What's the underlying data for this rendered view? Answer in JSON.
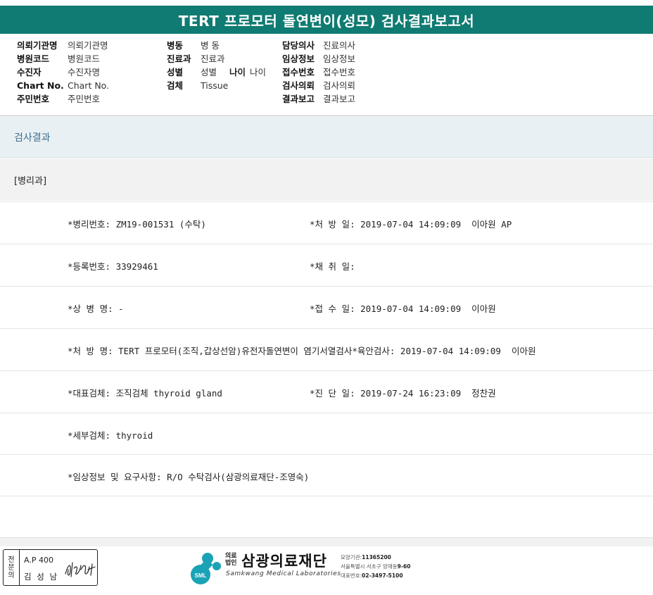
{
  "title": "TERT 프로모터 돌연변이(성모) 검사결과보고서",
  "header": {
    "col1": [
      {
        "label": "의뢰기관명",
        "value": "의뢰기관명"
      },
      {
        "label": "병원코드",
        "value": "병원코드"
      },
      {
        "label": "수진자",
        "value": "수진자명"
      },
      {
        "label": "Chart No.",
        "value": "Chart No."
      },
      {
        "label": "주민번호",
        "value": "주민번호"
      }
    ],
    "col2": [
      {
        "label": "병동",
        "value": "병 동"
      },
      {
        "label": "진료과",
        "value": "진료과"
      },
      {
        "label": "성별",
        "value": "성별"
      },
      {
        "label": "검체",
        "value": "Tissue"
      }
    ],
    "age": {
      "label": "나이",
      "value": "나이"
    },
    "col3": [
      {
        "label": "담당의사",
        "value": "진료의사"
      },
      {
        "label": "임상정보",
        "value": "임상정보"
      },
      {
        "label": "접수번호",
        "value": "접수번호"
      },
      {
        "label": "검사의뢰",
        "value": "검사의뢰"
      },
      {
        "label": "결과보고",
        "value": "결과보고"
      }
    ]
  },
  "section_title": "검사결과",
  "subsection_title": "[병리과]",
  "results": [
    {
      "left": "*병리번호: ZM19-001531 (수탁)",
      "right": "*처 방 일: 2019-07-04 14:09:09  이아원 AP"
    },
    {
      "left": "*등록번호: 33929461",
      "right": "*채 취 일:"
    },
    {
      "left": "*상 병 명: -",
      "right": "*접 수 일: 2019-07-04 14:09:09  이아원"
    },
    {
      "left": "*처 방 명: TERT 프로모터(조직,갑상선암)유전자돌연변이 염기서열검사*육안검사: 2019-07-04 14:09:09  이아원",
      "right": ""
    },
    {
      "left": "*대표검체: 조직검체 thyroid gland",
      "right": "*진 단 일: 2019-07-24 16:23:09  정찬권"
    },
    {
      "left": "*세부검체: thyroid",
      "right": ""
    },
    {
      "left": "*임상정보 및 요구사항: R/O 수탁검사(삼광의료재단-조영숙)",
      "right": ""
    }
  ],
  "stamp": {
    "vertical_label": [
      "전",
      "문",
      "의"
    ],
    "ap": "A.P 400",
    "name": "김 성 남"
  },
  "footer": {
    "legal_line1": "의료",
    "legal_line2": "법인",
    "org_name": "삼광의료재단",
    "org_name_en": "Samkwang Medical Laboratories",
    "logo_text": "SML",
    "info": [
      {
        "k": "요양기관:",
        "v": "11365200"
      },
      {
        "k": "서울특별시 서초구 양재동 ",
        "v": "9-60"
      },
      {
        "k": "대표번호:",
        "v": "02-3497-5100"
      }
    ]
  }
}
